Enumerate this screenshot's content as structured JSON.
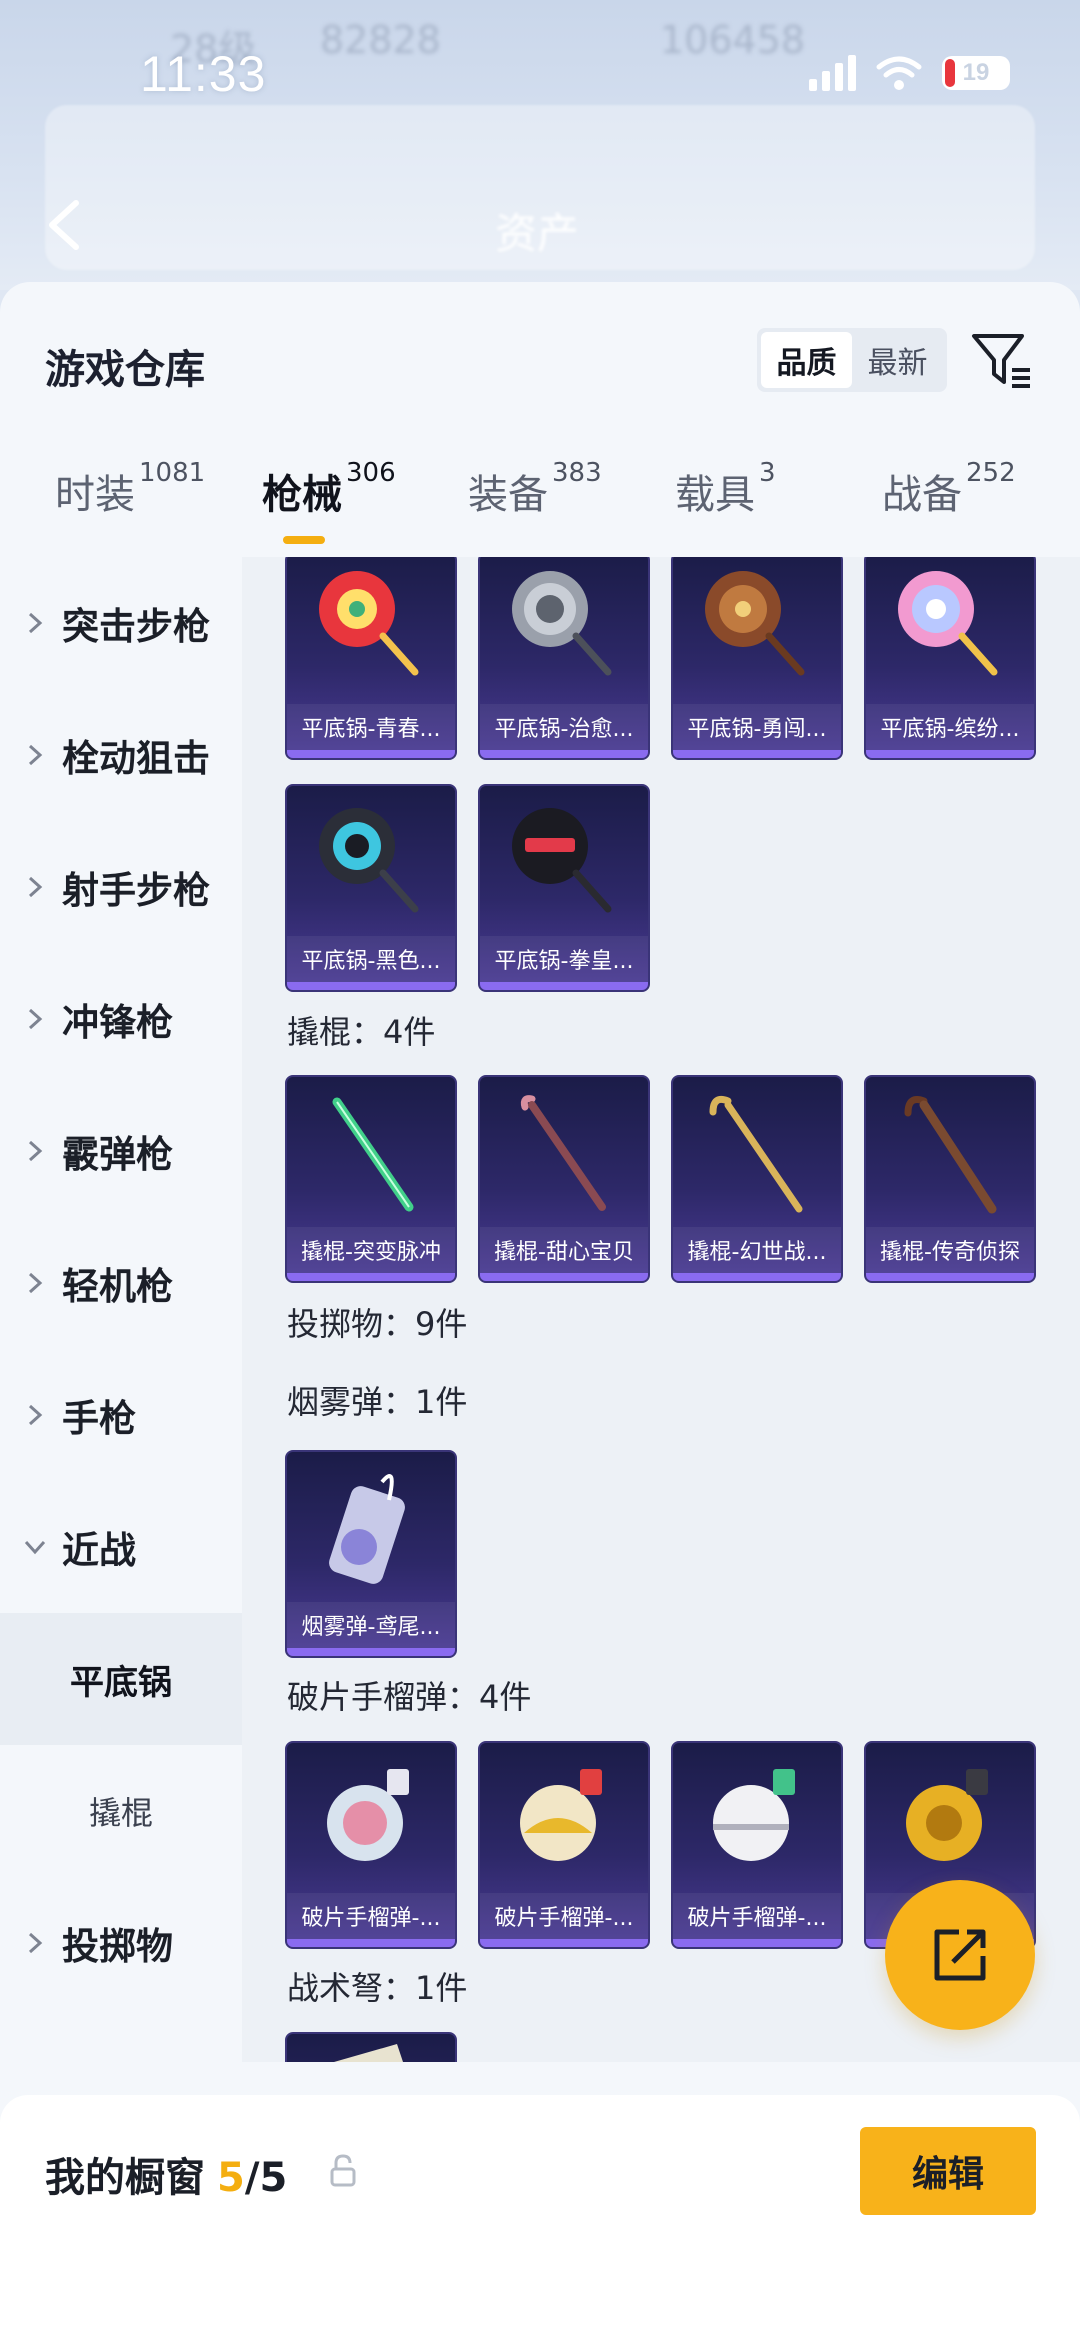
{
  "status_bar": {
    "time": "11:33",
    "battery": "19"
  },
  "background_header": {
    "blurred_texts": [
      "28级",
      "82828",
      "106458",
      "资产"
    ]
  },
  "panel": {
    "title": "游戏仓库",
    "sort": {
      "options": [
        "品质",
        "最新"
      ],
      "selected": "品质"
    }
  },
  "tabs": [
    {
      "label": "时装",
      "count": "1081"
    },
    {
      "label": "枪械",
      "count": "306",
      "active": true
    },
    {
      "label": "装备",
      "count": "383"
    },
    {
      "label": "载具",
      "count": "3"
    },
    {
      "label": "战备",
      "count": "252"
    }
  ],
  "sidebar": {
    "items": [
      {
        "label": "突击步枪"
      },
      {
        "label": "栓动狙击"
      },
      {
        "label": "射手步枪"
      },
      {
        "label": "冲锋枪"
      },
      {
        "label": "霰弹枪"
      },
      {
        "label": "轻机枪"
      },
      {
        "label": "手枪"
      },
      {
        "label": "近战",
        "expanded": true
      }
    ],
    "sub_items": [
      {
        "label": "平底锅",
        "selected": true
      },
      {
        "label": "撬棍"
      }
    ],
    "last_item": {
      "label": "投掷物"
    }
  },
  "content": {
    "pans": [
      {
        "name": "平底锅-青春...",
        "icon": "red-pan-icon"
      },
      {
        "name": "平底锅-治愈...",
        "icon": "silver-pan-icon"
      },
      {
        "name": "平底锅-勇闯...",
        "icon": "bronze-pan-icon"
      },
      {
        "name": "平底锅-缤纷...",
        "icon": "candy-pan-icon"
      },
      {
        "name": "平底锅-黑色...",
        "icon": "black-pan-icon"
      },
      {
        "name": "平底锅-拳皇...",
        "icon": "kof-pan-icon"
      }
    ],
    "crowbar_header": "撬棍：4件",
    "crowbars": [
      {
        "name": "撬棍-突变脉冲",
        "icon": "green-crowbar-icon"
      },
      {
        "name": "撬棍-甜心宝贝",
        "icon": "pink-crowbar-icon"
      },
      {
        "name": "撬棍-幻世战...",
        "icon": "gold-crowbar-icon"
      },
      {
        "name": "撬棍-传奇侦探",
        "icon": "umbrella-crowbar-icon"
      }
    ],
    "throwables_header": "投掷物：9件",
    "smoke_header": "烟雾弹：1件",
    "smoke": [
      {
        "name": "烟雾弹-鸢尾...",
        "icon": "smoke-grenade-icon"
      }
    ],
    "frag_header": "破片手榴弹：4件",
    "frags": [
      {
        "name": "破片手榴弹-...",
        "icon": "frag-grenade-1-icon"
      },
      {
        "name": "破片手榴弹-...",
        "icon": "frag-grenade-2-icon"
      },
      {
        "name": "破片手榴弹-...",
        "icon": "frag-grenade-3-icon"
      },
      {
        "name": "破片...",
        "icon": "frag-grenade-4-icon"
      }
    ],
    "crossbow_header": "战术弩：1件"
  },
  "bottom_bar": {
    "title": "我的橱窗",
    "current": "5",
    "total": "/5",
    "edit_label": "编辑"
  },
  "colors": {
    "accent": "#f8b21a",
    "card_top": "#1b1c48",
    "card_bottom": "#4b3b95"
  }
}
